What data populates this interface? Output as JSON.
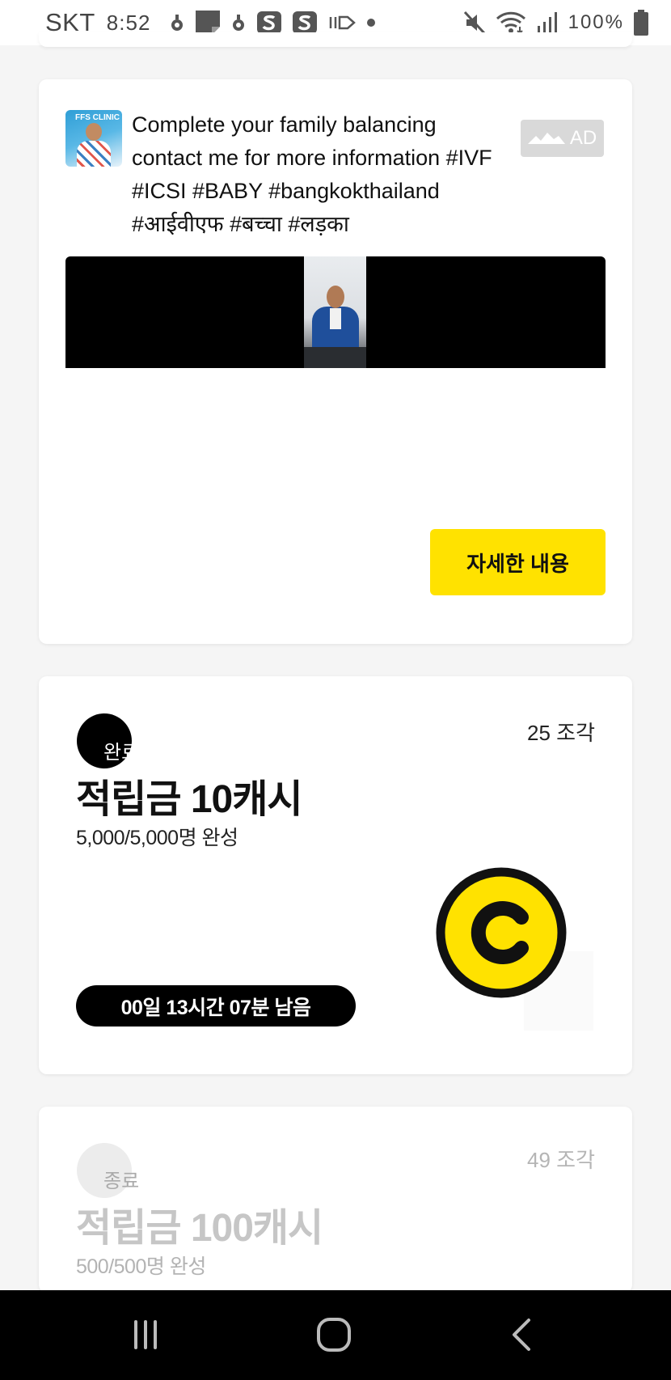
{
  "status_bar": {
    "carrier": "SKT",
    "time": "8:52",
    "battery": "100%"
  },
  "ad": {
    "text": "Complete your family balancing contact me for more information #IVF #ICSI #BABY #bangkokthailand #आईवीएफ #बच्चा #लड़का",
    "thumb_text": "FFS CLINIC",
    "badge": "AD",
    "cta_label": "자세한 내용"
  },
  "rewards": [
    {
      "status": "완료",
      "pieces": "25 조각",
      "title": "적립금 10캐시",
      "progress": "5,000/5,000명 완성",
      "time_left": "00일 13시간 07분 남음"
    },
    {
      "status": "종료",
      "pieces": "49 조각",
      "title": "적립금 100캐시",
      "progress": "500/500명 완성"
    }
  ],
  "colors": {
    "accent_yellow": "#ffe200",
    "black": "#000000",
    "faded_text": "#c6c6c6"
  },
  "icons": {
    "nav": [
      "recent-apps-icon",
      "home-icon",
      "back-icon"
    ],
    "coin": "cash-coin-icon"
  }
}
